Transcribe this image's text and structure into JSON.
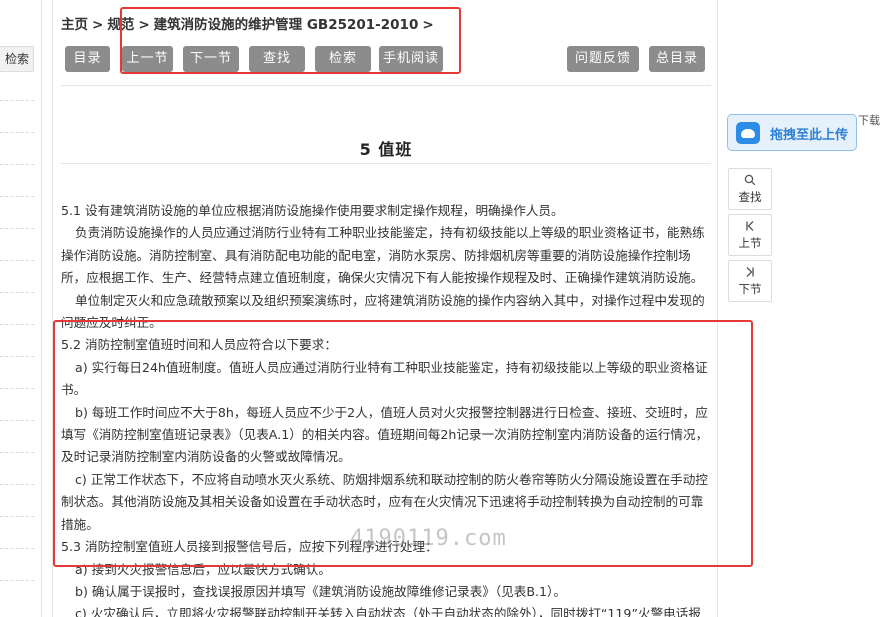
{
  "left_panel": {
    "search_label": "检索"
  },
  "breadcrumb": {
    "home": "主页",
    "sep1": ">",
    "spec": "规范",
    "sep2": ">",
    "current": "建筑消防设施的维护管理 GB25201-2010",
    "sep3": ">"
  },
  "toolbar": {
    "contents": "目录",
    "prev": "上一节",
    "next": "下一节",
    "find": "查找",
    "search": "检索",
    "mobile": "手机阅读",
    "feedback": "问题反馈",
    "all_contents": "总目录"
  },
  "chapter_title": "5 值班",
  "content": [
    "5.1 设有建筑消防设施的单位应根据消防设施操作使用要求制定操作规程，明确操作人员。",
    "负责消防设施操作的人员应通过消防行业特有工种职业技能鉴定，持有初级技能以上等级的职业资格证书，能熟练操作消防设施。消防控制室、具有消防配电功能的配电室，消防水泵房、防排烟机房等重要的消防设施操作控制场所，应根据工作、生产、经营特点建立值班制度，确保火灾情况下有人能按操作规程及时、正确操作建筑消防设施。",
    "单位制定灭火和应急疏散预案以及组织预案演练时，应将建筑消防设施的操作内容纳入其中，对操作过程中发现的问题应及时纠正。",
    "5.2 消防控制室值班时间和人员应符合以下要求：",
    "a) 实行每日24h值班制度。值班人员应通过消防行业特有工种职业技能鉴定，持有初级技能以上等级的职业资格证书。",
    "b) 每班工作时间应不大于8h，每班人员应不少于2人，值班人员对火灾报警控制器进行日检查、接班、交班时，应填写《消防控制室值班记录表》（见表A.1）的相关内容。值班期间每2h记录一次消防控制室内消防设备的运行情况，及时记录消防控制室内消防设备的火警或故障情况。",
    "c) 正常工作状态下，不应将自动喷水灭火系统、防烟排烟系统和联动控制的防火卷帘等防火分隔设施设置在手动控制状态。其他消防设施及其相关设备如设置在手动状态时，应有在火灾情况下迅速将手动控制转换为自动控制的可靠措施。",
    "5.3 消防控制室值班人员接到报警信号后，应按下列程序进行处理：",
    "a) 接到火灾报警信息后，应以最快方式确认。",
    "b) 确认属于误报时，查找误报原因并填写《建筑消防设施故障维修记录表》（见表B.1）。",
    "c) 火灾确认后，立即将火灾报警联动控制开关转入自动状态（处于自动状态的除外），同时拨打“119”火警电话报"
  ],
  "watermark": "4190119.com",
  "right_panel": {
    "upload_label": "拖拽至此上传",
    "edge_text": "下载",
    "find": "查找",
    "prev": "上节",
    "next": "下节",
    "find_icon": "search-icon",
    "prev_icon": "skip-back-icon",
    "next_icon": "skip-forward-icon"
  },
  "colors": {
    "button_gray": "#8c8c8c",
    "highlight_red": "#e53935",
    "upload_blue": "#2d8ce6"
  }
}
